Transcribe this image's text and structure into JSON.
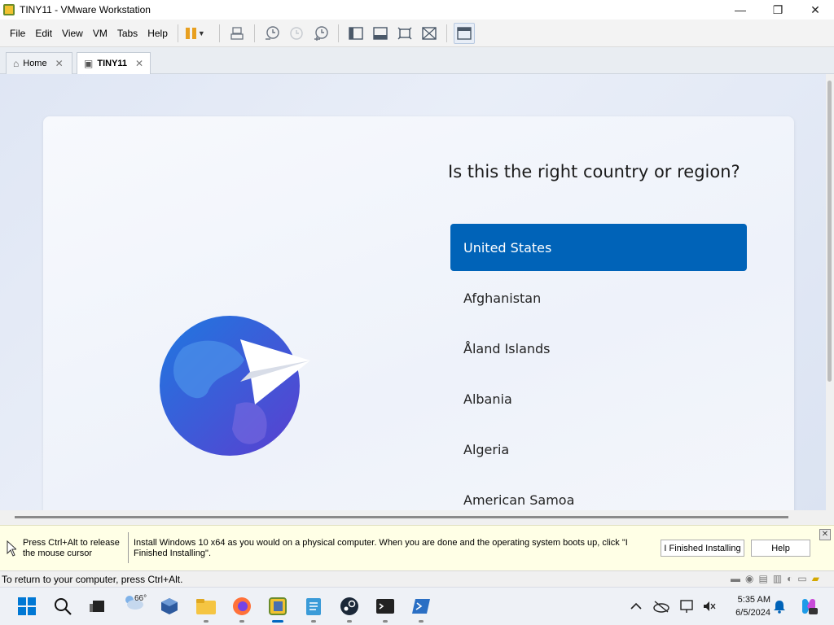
{
  "window": {
    "title": "TINY11 - VMware Workstation",
    "minimize": "—",
    "maximize": "❐",
    "close": "✕"
  },
  "menu": [
    "File",
    "Edit",
    "View",
    "VM",
    "Tabs",
    "Help"
  ],
  "tabs": [
    {
      "label": "Home",
      "icon": "home-icon",
      "close": "✕"
    },
    {
      "label": "TINY11",
      "icon": "vm-icon",
      "close": "✕"
    }
  ],
  "oobe": {
    "title": "Is this the right country or region?",
    "countries": [
      "United States",
      "Afghanistan",
      "Åland Islands",
      "Albania",
      "Algeria",
      "American Samoa"
    ],
    "selected_index": 0
  },
  "hint": {
    "release": "Press Ctrl+Alt to release the mouse cursor",
    "message": "Install Windows 10 x64 as you would on a physical computer. When you are done and the operating system boots up, click \"I Finished Installing\".",
    "finished_button": "I Finished Installing",
    "help_button": "Help",
    "close": "✕"
  },
  "status": {
    "text": "To return to your computer, press Ctrl+Alt."
  },
  "taskbar": {
    "weather_temp": "66°",
    "time": "5:35 AM",
    "date": "6/5/2024"
  },
  "colors": {
    "accent": "#0063b8",
    "hint_bg": "#ffffe6"
  }
}
